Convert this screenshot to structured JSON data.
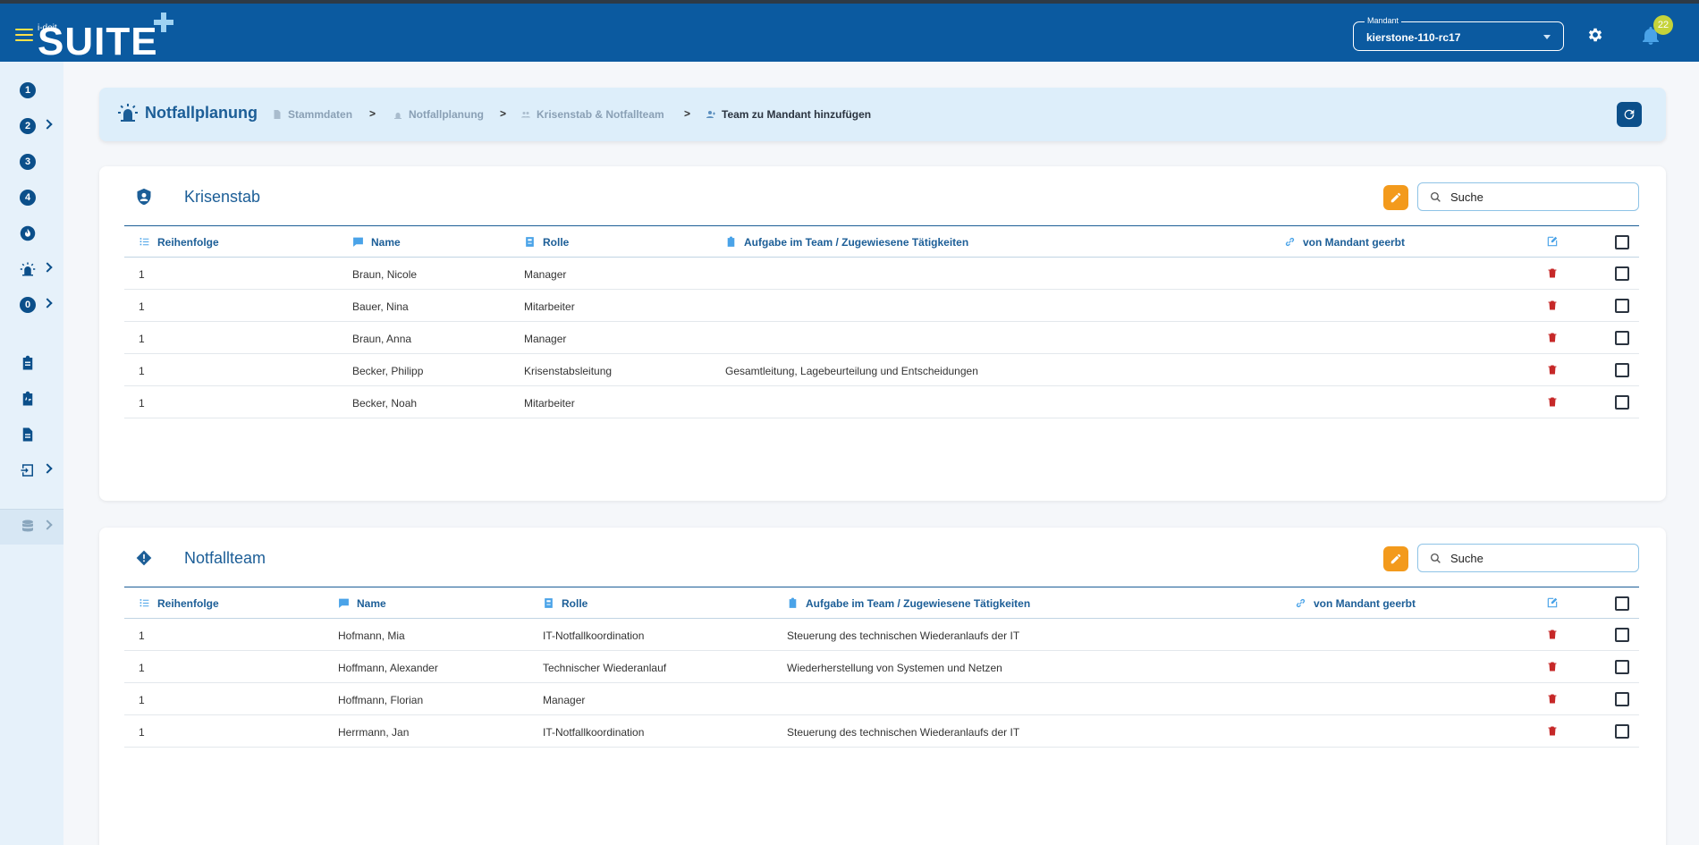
{
  "header": {
    "logo_small": "i-doit",
    "logo_big": "SUITE",
    "mandant_label": "Mandant",
    "mandant_value": "kierstone-110-rc17",
    "notifications_count": "22"
  },
  "sidebar": {
    "items": [
      {
        "label": "1",
        "has_submenu": false
      },
      {
        "label": "2",
        "has_submenu": true
      },
      {
        "label": "3",
        "has_submenu": false
      },
      {
        "label": "4",
        "has_submenu": false
      },
      {
        "icon": "fire-icon",
        "has_submenu": false
      },
      {
        "icon": "siren-icon",
        "has_submenu": true
      },
      {
        "label": "0",
        "has_submenu": true
      },
      {
        "icon": "clipboard-icon",
        "has_submenu": false
      },
      {
        "icon": "activity-icon",
        "has_submenu": false
      },
      {
        "icon": "document-icon",
        "has_submenu": false
      },
      {
        "icon": "import-icon",
        "has_submenu": true
      },
      {
        "icon": "database-icon",
        "has_submenu": true
      }
    ]
  },
  "breadcrumb": {
    "title": "Notfallplanung",
    "items": [
      "Stammdaten",
      "Notfallplanung",
      "Krisenstab & Notfallteam",
      "Team zu Mandant hinzufügen"
    ],
    "separator": ">"
  },
  "columns": {
    "order": "Reihenfolge",
    "name": "Name",
    "role": "Rolle",
    "task": "Aufgabe im Team / Zugewiesene Tätigkeiten",
    "inherited": "von Mandant geerbt"
  },
  "search_placeholder": "Suche",
  "krisenstab": {
    "title": "Krisenstab",
    "rows": [
      {
        "order": "1",
        "name": "Braun, Nicole",
        "role": "Manager",
        "task": ""
      },
      {
        "order": "1",
        "name": "Bauer, Nina",
        "role": "Mitarbeiter",
        "task": ""
      },
      {
        "order": "1",
        "name": "Braun, Anna",
        "role": "Manager",
        "task": ""
      },
      {
        "order": "1",
        "name": "Becker, Philipp",
        "role": "Krisenstabsleitung",
        "task": "Gesamtleitung, Lagebeurteilung und Entscheidungen"
      },
      {
        "order": "1",
        "name": "Becker, Noah",
        "role": "Mitarbeiter",
        "task": ""
      }
    ]
  },
  "notfallteam": {
    "title": "Notfallteam",
    "rows": [
      {
        "order": "1",
        "name": "Hofmann, Mia",
        "role": "IT-Notfallkoordination",
        "task": "Steuerung des technischen Wiederanlaufs der IT"
      },
      {
        "order": "1",
        "name": "Hoffmann, Alexander",
        "role": "Technischer Wiederanlauf",
        "task": "Wiederherstellung von Systemen und Netzen"
      },
      {
        "order": "1",
        "name": "Hoffmann, Florian",
        "role": "Manager",
        "task": ""
      },
      {
        "order": "1",
        "name": "Herrmann, Jan",
        "role": "IT-Notfallkoordination",
        "task": "Steuerung des technischen Wiederanlaufs der IT"
      }
    ]
  },
  "colors": {
    "topbar": "#0b5aa0",
    "accent": "#1c5e97",
    "edit": "#f39a1c",
    "delete": "#c62828",
    "badge": "#c5d33a"
  }
}
